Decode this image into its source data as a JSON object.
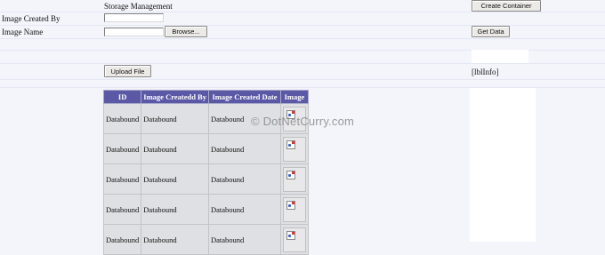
{
  "header": {
    "title": "Storage Management",
    "create_container_label": "Create Container"
  },
  "form": {
    "image_created_by_label": "Image Created By",
    "image_created_by_value": "",
    "image_name_label": "Image Name",
    "image_name_value": "",
    "browse_label": "Browse...",
    "get_data_label": "Get Data",
    "upload_file_label": "Upload File",
    "info_label": "[lblInfo]"
  },
  "grid": {
    "columns": [
      "ID",
      "Image Createdd By",
      "Image Created Date",
      "Image"
    ],
    "rows": [
      {
        "id": "Databound",
        "created_by": "Databound",
        "created_date": "Databound",
        "image": "broken-image-icon"
      },
      {
        "id": "Databound",
        "created_by": "Databound",
        "created_date": "Databound",
        "image": "broken-image-icon"
      },
      {
        "id": "Databound",
        "created_by": "Databound",
        "created_date": "Databound",
        "image": "broken-image-icon"
      },
      {
        "id": "Databound",
        "created_by": "Databound",
        "created_date": "Databound",
        "image": "broken-image-icon"
      },
      {
        "id": "Databound",
        "created_by": "Databound",
        "created_date": "Databound",
        "image": "broken-image-icon"
      }
    ]
  },
  "watermark": "© DotNetCurry.com"
}
